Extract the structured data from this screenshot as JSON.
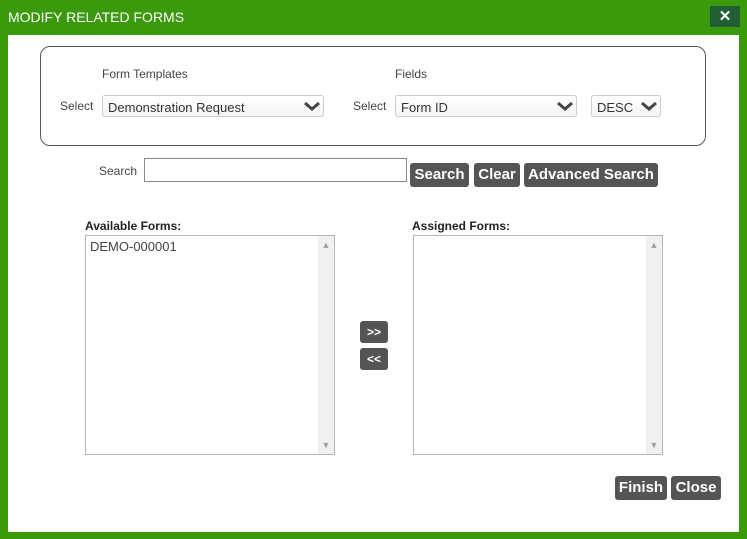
{
  "dialog": {
    "title": "MODIFY RELATED FORMS",
    "close_icon": "✕"
  },
  "filters": {
    "form_templates_label": "Form Templates",
    "fields_label": "Fields",
    "select_label_1": "Select",
    "select_label_2": "Select",
    "form_template_value": "Demonstration Request",
    "field_value": "Form ID",
    "sort_value": "DESC"
  },
  "search": {
    "label": "Search",
    "value": "",
    "search_button": "Search",
    "clear_button": "Clear",
    "advanced_button": "Advanced Search"
  },
  "available": {
    "title": "Available Forms:",
    "items": [
      "DEMO-000001"
    ]
  },
  "assigned": {
    "title": "Assigned Forms:",
    "items": []
  },
  "move": {
    "add": ">>",
    "remove": "<<"
  },
  "footer": {
    "finish_button": "Finish",
    "close_button": "Close"
  },
  "colors": {
    "titlebar": "#3a9a0c",
    "close_button_bg": "#1f5f33",
    "button_bg": "#555555"
  }
}
